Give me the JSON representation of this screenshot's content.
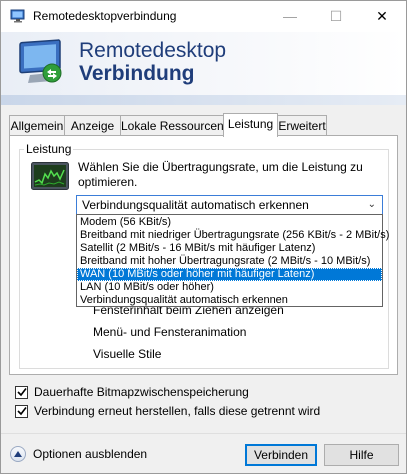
{
  "window": {
    "title": "Remotedesktopverbindung",
    "controls": {
      "minimize": "—",
      "maximize": "☐",
      "close": "✕"
    }
  },
  "banner": {
    "title_line1": "Remotedesktop",
    "title_line2": "Verbindung",
    "accent_color": "#1f3d7a"
  },
  "tabs": [
    {
      "label": "Allgemein",
      "active": false
    },
    {
      "label": "Anzeige",
      "active": false
    },
    {
      "label": "Lokale Ressourcen",
      "active": false
    },
    {
      "label": "Leistung",
      "active": true
    },
    {
      "label": "Erweitert",
      "active": false
    }
  ],
  "performance": {
    "group_label": "Leistung",
    "icon": "performance-monitor-icon",
    "description_line1": "Wählen Sie die Übertragungsrate, um die Leistung zu",
    "description_line2": "optimieren.",
    "connection_select": {
      "selected": "Verbindungsqualität automatisch erkennen",
      "options": [
        "Modem (56 KBit/s)",
        "Breitband mit niedriger Übertragungsrate (256 KBit/s - 2 MBit/s)",
        "Satellit (2 MBit/s - 16 MBit/s mit häufiger Latenz)",
        "Breitband mit hoher Übertragungsrate (2 MBit/s - 10 MBit/s)",
        "WAN (10 MBit/s oder höher mit häufiger Latenz)",
        "LAN (10 MBit/s oder höher)",
        "Verbindungsqualität automatisch erkennen"
      ],
      "highlighted_option": "WAN (10 MBit/s oder höher mit häufiger Latenz)",
      "highlight_color": "#0078d7"
    },
    "features": [
      "Fensterinhalt beim Ziehen anzeigen",
      "Menü- und Fensteranimation",
      "Visuelle Stile"
    ]
  },
  "checkboxes": [
    {
      "label": "Dauerhafte Bitmapzwischenspeicherung",
      "checked": true
    },
    {
      "label": "Verbindung erneut herstellen, falls diese getrennt wird",
      "checked": true
    }
  ],
  "footer": {
    "options_label": "Optionen ausblenden",
    "connect_label": "Verbinden",
    "help_label": "Hilfe"
  }
}
